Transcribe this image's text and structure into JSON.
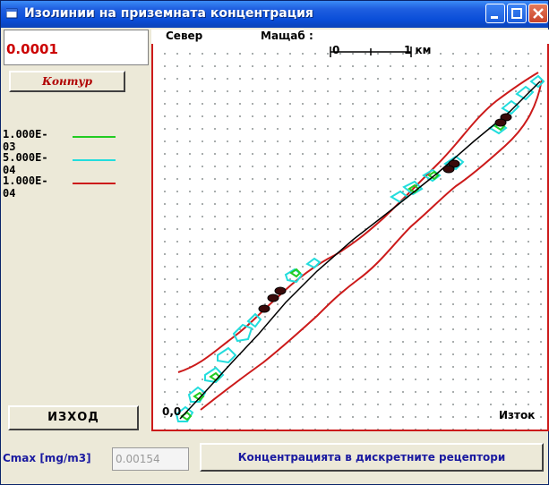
{
  "window": {
    "title": "Изолинии на приземната концентрация",
    "controls": [
      "minimize-button",
      "maximize-button",
      "close-button"
    ]
  },
  "left_panel": {
    "value": "0.0001",
    "contour_button": "Контур",
    "legend": [
      {
        "label": "1.000E-03",
        "color": "#22cc22"
      },
      {
        "label": "5.000E-04",
        "color": "#22dddd"
      },
      {
        "label": "1.000E-04",
        "color": "#cc1a1a"
      }
    ],
    "exit_button": "ИЗХОД"
  },
  "map": {
    "north_label": "Север",
    "scale_label": "Мащаб :",
    "scale_start": "0",
    "scale_end": "1 км",
    "origin_label": "0,0",
    "east_label": "Изток"
  },
  "bottom": {
    "cmax_label": "Cmax [mg/m3]",
    "cmax_value": "0.00154",
    "receptors_button": "Концентрацията в дискретните рецептори"
  },
  "colors": {
    "title_bar": "#0a4ed8",
    "value_text": "#cc0000",
    "map_border": "#cc1a1a",
    "label_blue": "#1a1aa0"
  }
}
